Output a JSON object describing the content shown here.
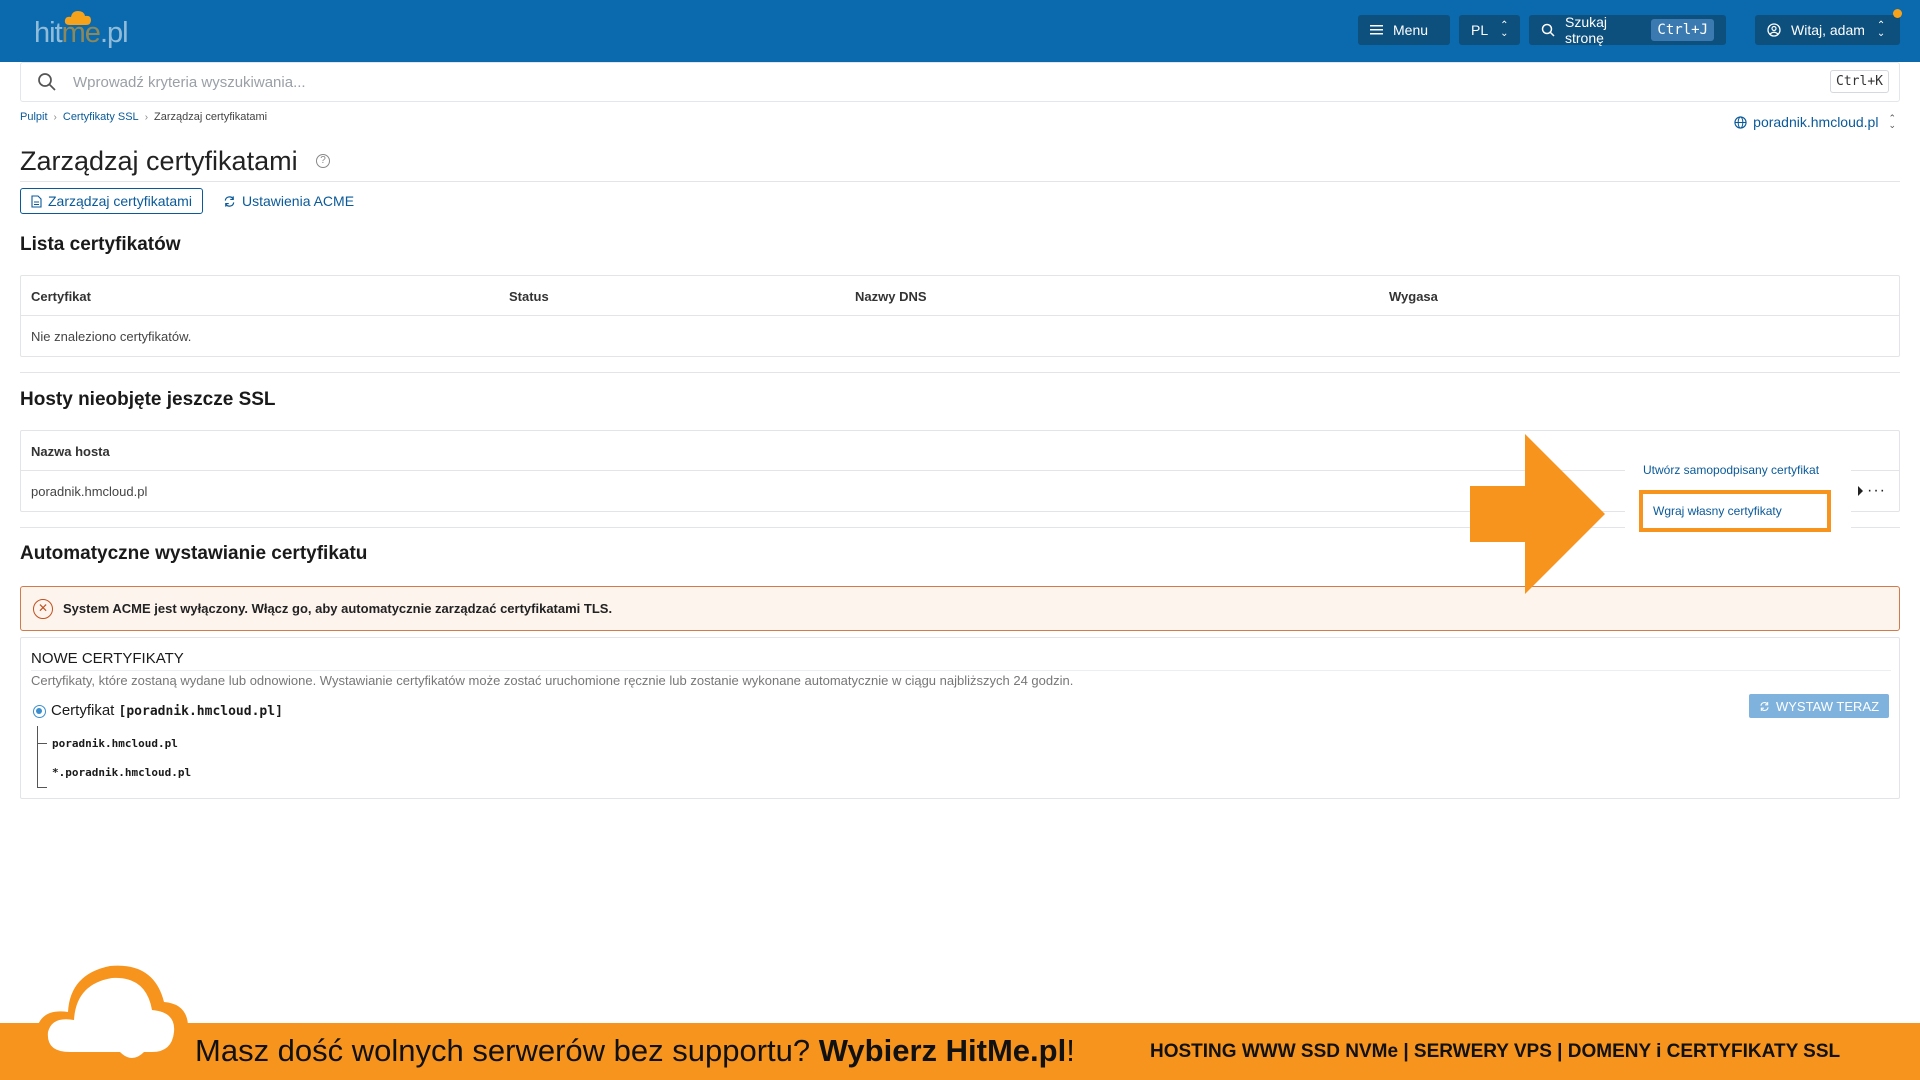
{
  "brand": {
    "logo_text_a": "hit",
    "logo_text_b": "me",
    "logo_text_c": ".pl",
    "accent": "#f7941d",
    "primary": "#0a6aad"
  },
  "topbar": {
    "menu_label": "Menu",
    "lang_label": "PL",
    "search_page_label": "Szukaj stronę",
    "search_page_shortcut": "Ctrl+J",
    "user_label": "Witaj, adam"
  },
  "search": {
    "placeholder": "Wprowadź kryteria wyszukiwania...",
    "shortcut": "Ctrl+K"
  },
  "breadcrumb": {
    "items": [
      "Pulpit",
      "Certyfikaty SSL",
      "Zarządzaj certyfikatami"
    ]
  },
  "domain_selector": {
    "value": "poradnik.hmcloud.pl"
  },
  "page_title": "Zarządzaj certyfikatami",
  "tabs": [
    {
      "label": "Zarządzaj certyfikatami",
      "active": true
    },
    {
      "label": "Ustawienia ACME",
      "active": false
    }
  ],
  "cert_list": {
    "title": "Lista certyfikatów",
    "columns": [
      "Certyfikat",
      "Status",
      "Nazwy DNS",
      "Wygasa"
    ],
    "empty_text": "Nie znaleziono certyfikatów."
  },
  "hosts": {
    "title": "Hosty nieobjęte jeszcze SSL",
    "column": "Nazwa hosta",
    "rows": [
      "poradnik.hmcloud.pl"
    ],
    "menu": [
      "Utwórz samopodpisany certyfikat",
      "Wgraj własny certyfikaty"
    ]
  },
  "acme": {
    "title": "Automatyczne wystawianie certyfikatu",
    "alert": "System ACME jest wyłączony. Włącz go, aby automatycznie zarządzać certyfikatami TLS.",
    "new_title": "NOWE CERTYFIKATY",
    "new_desc": "Certyfikaty, które zostaną wydane lub odnowione. Wystawianie certyfikatów może zostać uruchomione ręcznie lub zostanie wykonane automatycznie w ciągu najbliższych 24 godzin.",
    "cert_prefix": "Certyfikat",
    "cert_name": "[poradnik.hmcloud.pl]",
    "hosts": [
      "poradnik.hmcloud.pl",
      "*.poradnik.hmcloud.pl"
    ],
    "issue_button": "WYSTAW TERAZ"
  },
  "banner": {
    "text_a": "Masz dość wolnych serwerów bez supportu? ",
    "text_b": "Wybierz HitMe.pl",
    "text_c": "!",
    "right": "HOSTING WWW SSD NVMe | SERWERY VPS | DOMENY i CERTYFIKATY SSL"
  }
}
